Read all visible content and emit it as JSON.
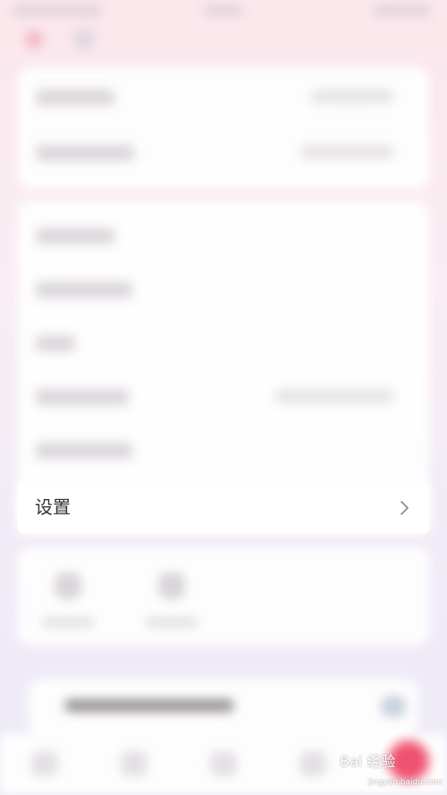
{
  "settings_row": {
    "label": "设置",
    "chevron_icon": "chevron-right-icon"
  },
  "watermark": {
    "brand": "Bai 经验",
    "url": "jingyan.baidu.com"
  },
  "colors": {
    "background_top": "#fbe7ec",
    "background_bottom": "#ece9f6",
    "card": "#ffffff",
    "label_text": "#333333",
    "accent": "#f04b6a"
  }
}
